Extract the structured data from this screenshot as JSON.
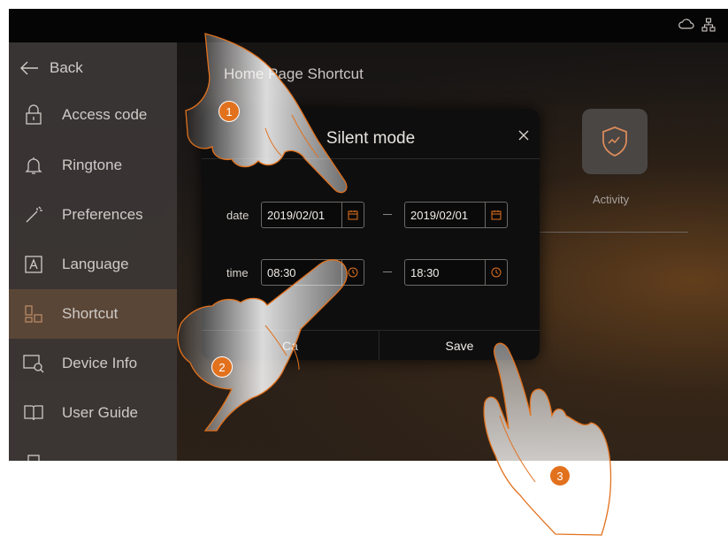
{
  "sidebar": {
    "back_label": "Back",
    "items": [
      {
        "label": "Access code",
        "icon": "lock-icon"
      },
      {
        "label": "Ringtone",
        "icon": "bell-icon"
      },
      {
        "label": "Preferences",
        "icon": "magic-wand-icon"
      },
      {
        "label": "Language",
        "icon": "language-icon"
      },
      {
        "label": "Shortcut",
        "icon": "shortcut-icon"
      },
      {
        "label": "Device Info",
        "icon": "device-info-icon"
      },
      {
        "label": "User Guide",
        "icon": "book-icon"
      }
    ],
    "active_item": "Shortcut"
  },
  "main": {
    "title": "Home Page Shortcut",
    "tile_label": "Activity",
    "tile_icon": "shield-icon"
  },
  "dialog": {
    "title": "Silent mode",
    "date_label": "date",
    "date_from": "2019/02/01",
    "date_to": "2019/02/01",
    "time_label": "time",
    "time_from": "08:30",
    "time_to": "18:30",
    "cancel_label": "Ca",
    "save_label": "Save"
  },
  "steps": [
    "1",
    "2",
    "3"
  ],
  "colors": {
    "accent": "#e2711d",
    "sidebar_bg": "#3e3a38",
    "dialog_bg": "#0e0e0e"
  }
}
